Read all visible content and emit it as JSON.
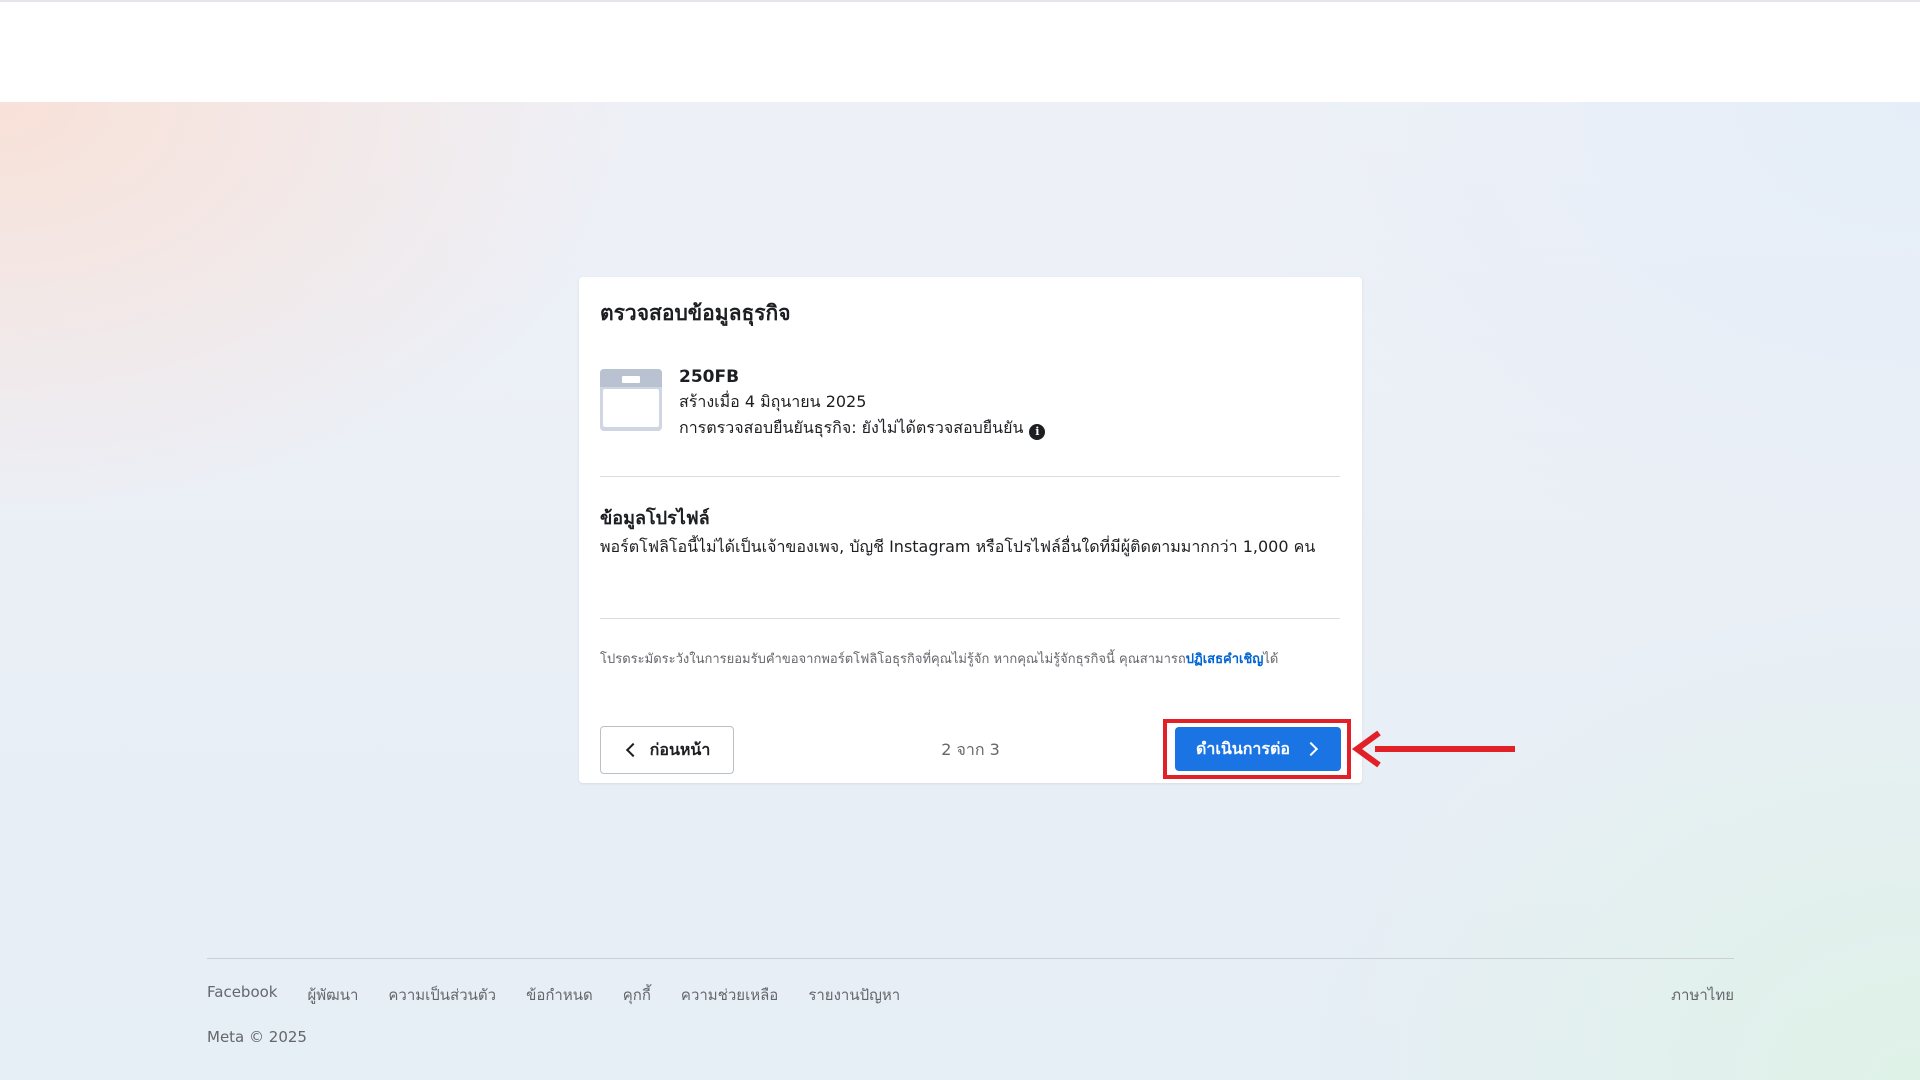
{
  "card": {
    "title": "ตรวจสอบข้อมูลธุรกิจ",
    "business": {
      "icon": "briefcase-icon",
      "name": "250FB",
      "created": "สร้างเมื่อ 4 มิถุนายน 2025",
      "verification": "การตรวจสอบยืนยันธุรกิจ: ยังไม่ได้ตรวจสอบยืนยัน"
    },
    "profile": {
      "title": "ข้อมูลโปรไฟล์",
      "description": "พอร์ตโฟลิโอนี้ไม่ได้เป็นเจ้าของเพจ, บัญชี Instagram หรือโปรไฟล์อื่นใดที่มีผู้ติดตามมากกว่า 1,000 คน"
    },
    "caution": {
      "text": "โปรดระมัดระวังในการยอมรับคำขอจากพอร์ตโฟลิโอธุรกิจที่คุณไม่รู้จัก หากคุณไม่รู้จักธุรกิจนี้ คุณสามารถ",
      "link": "ปฏิเสธคำเชิญ",
      "suffix": "ได้"
    },
    "back_label": "ก่อนหน้า",
    "step": "2 จาก 3",
    "next_label": "ดำเนินการต่อ"
  },
  "annotation": {
    "highlight_color": "#e12127"
  },
  "footer": {
    "links": [
      "Facebook",
      "ผู้พัฒนา",
      "ความเป็นส่วนตัว",
      "ข้อกำหนด",
      "คุกกี้",
      "ความช่วยเหลือ",
      "รายงานปัญหา"
    ],
    "language": "ภาษาไทย",
    "copyright": "Meta © 2025"
  }
}
